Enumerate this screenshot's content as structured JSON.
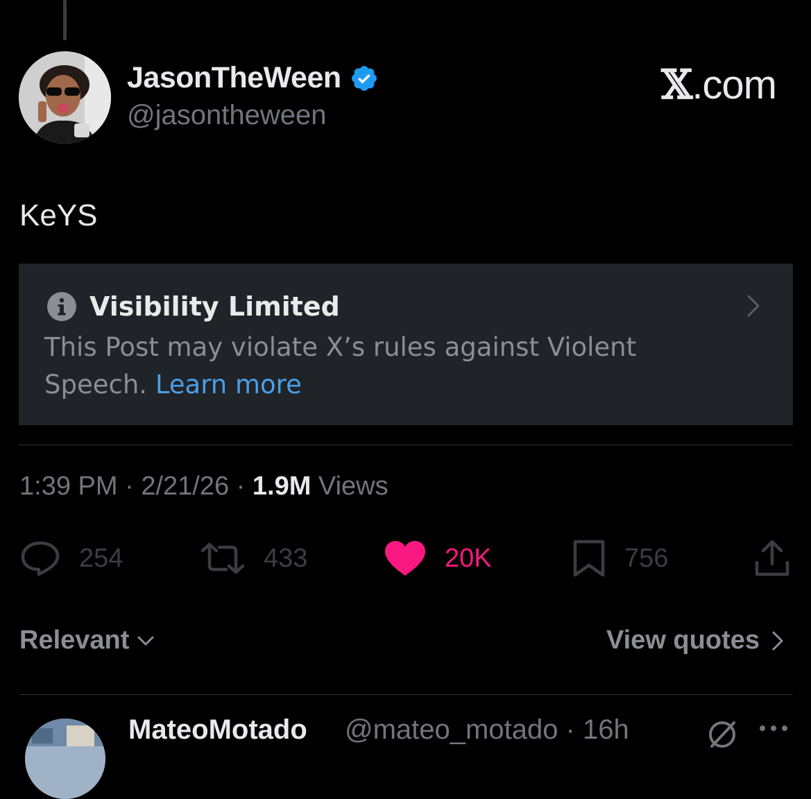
{
  "author": {
    "display_name": "JasonTheWeen",
    "handle": "@jasontheween",
    "verified": true
  },
  "brand": {
    "x_mark": "𝕏",
    "suffix": ".com"
  },
  "post": {
    "text": "KeYS"
  },
  "notice": {
    "title": "Visibility Limited",
    "body": "This Post may violate X’s rules against Violent Speech. ",
    "link_label": "Learn more"
  },
  "meta": {
    "time": "1:39 PM",
    "sep1": " · ",
    "date": "2/21/26",
    "sep2": " · ",
    "views_count": "1.9M",
    "views_label": " Views"
  },
  "actions": {
    "replies": "254",
    "reposts": "433",
    "likes": "20K",
    "bookmarks": "756"
  },
  "colors": {
    "background": "#000000",
    "like_pink": "#f91880",
    "link_blue": "#4a9fe8",
    "verified_blue": "#1d9bf0",
    "notice_bg": "#202327"
  },
  "sort": {
    "label": "Relevant"
  },
  "quotes": {
    "label": "View quotes"
  },
  "reply": {
    "display_name": "MateoMotado",
    "handle_time": "@mateo_motado · 16h"
  },
  "icons": {
    "verified": "verified-badge-icon",
    "info": "info-icon",
    "chevron": "chevron-right-icon",
    "reply": "comment-icon",
    "repost": "repost-icon",
    "like": "heart-icon",
    "bookmark": "bookmark-icon",
    "share": "share-icon",
    "grok": "grok-icon",
    "more": "more-icon"
  }
}
